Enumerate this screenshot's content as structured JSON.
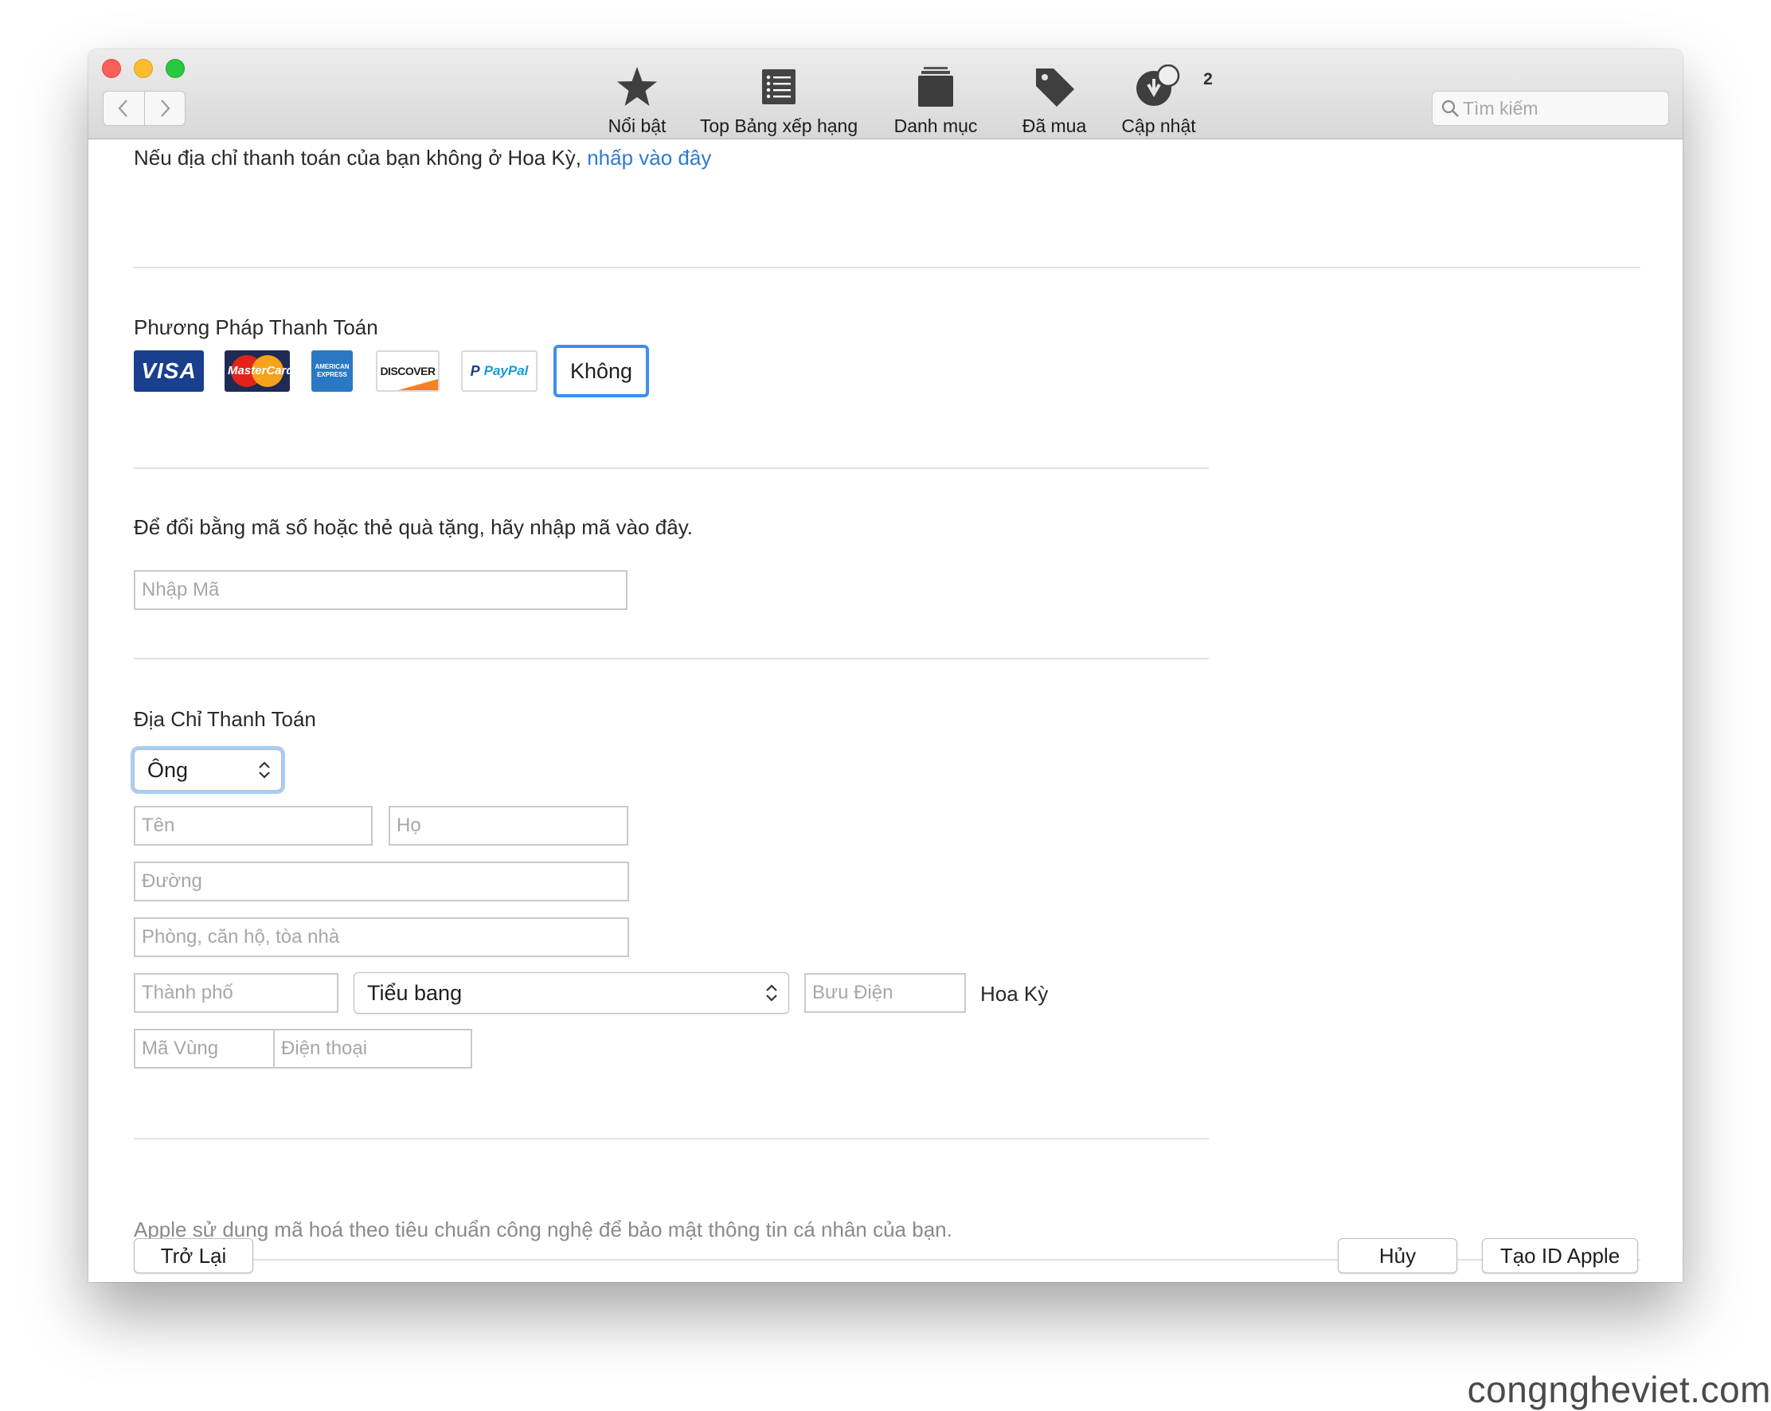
{
  "toolbar": {
    "tabs": [
      {
        "label": "Nổi bật",
        "icon": "star-icon"
      },
      {
        "label": "Top Bảng xếp hạng",
        "icon": "list-icon"
      },
      {
        "label": "Danh mục",
        "icon": "stack-icon"
      },
      {
        "label": "Đã mua",
        "icon": "tag-icon"
      },
      {
        "label": "Cập nhật",
        "icon": "update-icon"
      }
    ],
    "update_badge": "2",
    "search_placeholder": "Tìm kiếm"
  },
  "notice": {
    "text": "Nếu địa chỉ thanh toán của bạn không ở Hoa Kỳ,",
    "link": "nhấp vào đây"
  },
  "payment": {
    "heading": "Phương Pháp Thanh Toán",
    "cards": [
      "VISA",
      "MasterCard",
      "AMERICAN EXPRESS",
      "DISCOVER",
      "PayPal"
    ],
    "none_label": "Không",
    "selected": "Không"
  },
  "redeem": {
    "text": "Để đổi bằng mã số hoặc thẻ quà tặng, hãy nhập mã vào đây.",
    "placeholder": "Nhập Mã"
  },
  "billing": {
    "heading": "Địa Chỉ Thanh Toán",
    "salutation": "Ông",
    "first_name_placeholder": "Tên",
    "last_name_placeholder": "Họ",
    "street_placeholder": "Đường",
    "apt_placeholder": "Phòng, căn hộ, tòa nhà",
    "city_placeholder": "Thành phố",
    "state": "Tiểu bang",
    "zip_placeholder": "Bưu Điện",
    "country": "Hoa Kỳ",
    "area_code_placeholder": "Mã Vùng",
    "phone_placeholder": "Điện thoại"
  },
  "footer": {
    "security_note": "Apple sử dụng mã hoá theo tiêu chuẩn công nghệ để bảo mật thông tin cá nhân của bạn.",
    "back": "Trở Lại",
    "cancel": "Hủy",
    "create": "Tạo ID Apple"
  },
  "watermark": "congngheviet.com",
  "colors": {
    "accent": "#2e7bd1",
    "focus_ring": "#6aa7ee",
    "visa": "#1a3f8f",
    "amex": "#2a78c4"
  }
}
